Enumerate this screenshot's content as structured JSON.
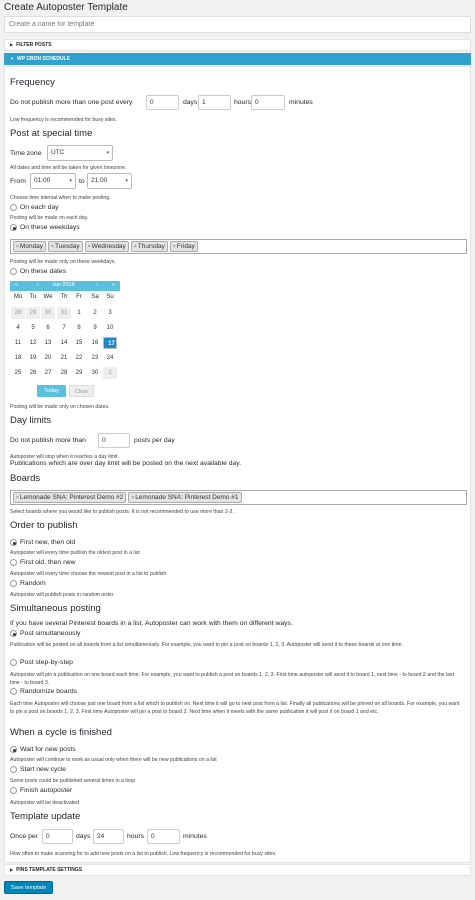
{
  "page_title": "Create Autoposter Template",
  "name_input": {
    "placeholder": "Create a name for template"
  },
  "sections": {
    "filter_posts": "FILTER POSTS",
    "cron": "WP CRON SCHEDULE",
    "pins": "PINS TEMPLATE SETTINGS"
  },
  "frequency": {
    "title": "Frequency",
    "prefix": "Do not publish more than one post every",
    "days_value": "0",
    "days_label": "days",
    "hours_value": "1",
    "hours_label": "hours",
    "minutes_value": "0",
    "minutes_label": "minutes",
    "hint": "Low frequency is recommended for busy sites."
  },
  "special_time": {
    "title": "Post at special time",
    "tz_label": "Time zone",
    "tz_value": "UTC",
    "tz_hint": "All dates and time will be taken for given timezone.",
    "from_label": "From",
    "from_value": "01:00",
    "to_label": "to",
    "to_value": "21:00",
    "interval_hint": "Choose time interval when to make posting.",
    "each_day_label": "On each day",
    "each_day_hint": "Posting will be made on each day.",
    "weekdays_label": "On these weekdays",
    "weekdays": [
      "Monday",
      "Tuesday",
      "Wednesday",
      "Thursday",
      "Friday"
    ],
    "weekdays_hint": "Posting will be made only on these weekdays.",
    "dates_label": "On these dates",
    "dates_hint": "Posting will be made only on chosen dates."
  },
  "calendar": {
    "prev": "«",
    "prev2": "‹",
    "month": "Jun 2018",
    "next": "›",
    "next2": "»",
    "dows": [
      "Mo",
      "Tu",
      "We",
      "Th",
      "Fr",
      "Sa",
      "Su"
    ],
    "rows": [
      [
        "28",
        "29",
        "30",
        "31",
        "1",
        "2",
        "3"
      ],
      [
        "4",
        "5",
        "6",
        "7",
        "8",
        "9",
        "10"
      ],
      [
        "11",
        "12",
        "13",
        "14",
        "15",
        "16",
        "17"
      ],
      [
        "18",
        "19",
        "20",
        "21",
        "22",
        "23",
        "24"
      ],
      [
        "25",
        "26",
        "27",
        "28",
        "29",
        "30",
        "1"
      ]
    ],
    "today_label": "Today",
    "clear_label": "Clear"
  },
  "day_limits": {
    "title": "Day limits",
    "prefix": "Do not publish more than",
    "value": "0",
    "suffix": "posts per day",
    "hint": "Autoposter will stop when it reaches a day limit.",
    "note": "Publications which are over day limit will be posted on the next available day."
  },
  "boards": {
    "title": "Boards",
    "items": [
      "Lemonade SNA: Pinterest Demo #2",
      "Lemonade SNA: Pinterest Demo #1"
    ],
    "hint": "Select boards where you would like to publish posts. It is not recommended to use more than 2-3."
  },
  "order": {
    "title": "Order to publish",
    "opt1": "First new, then old",
    "opt1_hint": "Autoposter will every time publish the oldest post in a list",
    "opt2": "First old, then new",
    "opt2_hint": "Autoposter will every time choose the newest post in a list to publish",
    "opt3": "Random",
    "opt3_hint": "Autoposter will publish posts in random order"
  },
  "simultaneous": {
    "title": "Simultaneous posting",
    "intro": "If you have several Pinterest boards in a list, Autoposter can work with them on different ways.",
    "opt1": "Post simultaneously",
    "opt1_hint": "Publication will be posted on all boards from a list simultaneously. For example, you want to pin a post on boards 1, 2, 3. Autoposter will send it to these boards at one time.",
    "opt2": "Post step-by-step",
    "opt2_hint": "Autoposter will pin a publication on one board each time. For example, you want to publish a post on boards 1, 2, 3. First time autoposter will send it to board 1, next time - to board 2 and the last time - to board 3.",
    "opt3": "Randomize boards",
    "opt3_hint": "Each time Autoposter will choose just one board from a list which to publish on. Next time it will go to next post from a list. Finally all publications will be pinned on all boards. For example, you want to pin a post on boards 1, 2, 3. First time Autoposter will pin a post to board 2. Next time when it meets with the same publication it will post it on board 1 and etc."
  },
  "cycle": {
    "title": "When a cycle is finished",
    "opt1": "Wait for new posts",
    "opt1_hint": "Autoposter will continue to work as usual only when there will be new publications on a list",
    "opt2": "Start new cycle",
    "opt2_hint": "Some posts could be published several times in a loop",
    "opt3": "Finish autoposter",
    "opt3_hint": "Autoposter will be deactivated"
  },
  "template_update": {
    "title": "Template update",
    "prefix": "Once per",
    "days_value": "0",
    "days_label": "days",
    "hours_value": "24",
    "hours_label": "hours",
    "minutes_value": "0",
    "minutes_label": "minutes",
    "hint": "How often to make scanning for to add new posts on a list to publish. Low frequency is recommended for busy sites."
  },
  "save_label": "Save template"
}
